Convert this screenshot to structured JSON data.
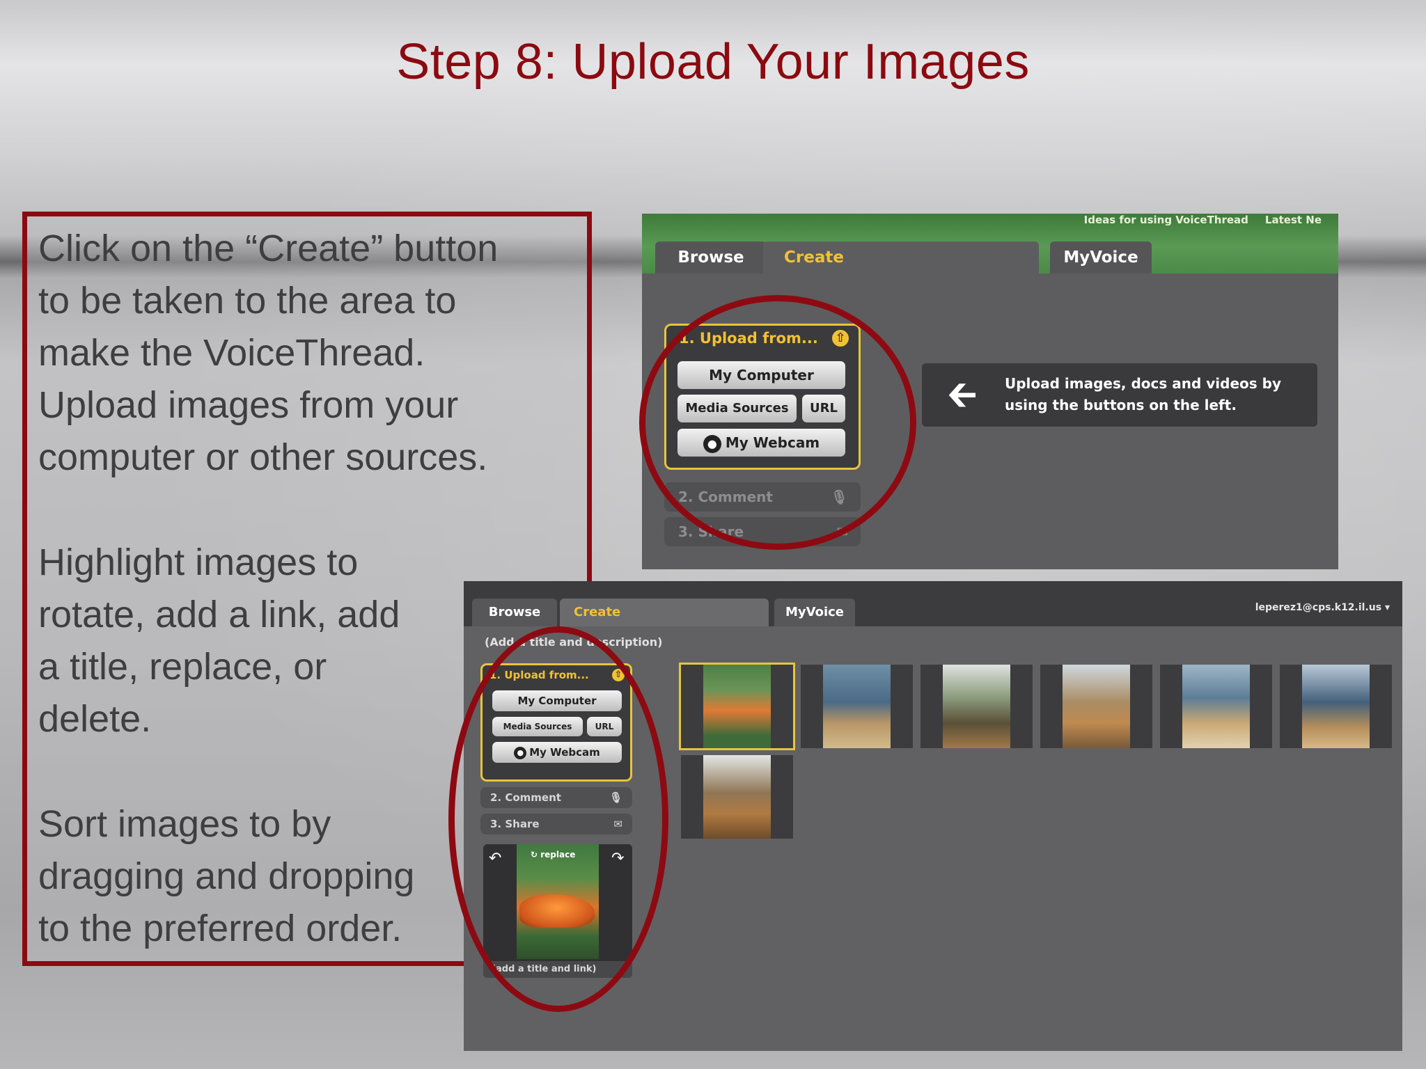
{
  "slide": {
    "title": "Step 8: Upload Your Images",
    "paragraphs": [
      "Click on the “Create” button\nto be taken to the area to\nmake the VoiceThread.\nUpload images from your\ncomputer or other sources.",
      "Highlight images to\nrotate, add a link, add\na title, replace, or\ndelete.",
      "Sort images to by\ndragging and dropping\nto the preferred order."
    ]
  },
  "shot1": {
    "top_links": [
      "Ideas for using VoiceThread",
      "Latest Ne"
    ],
    "tabs": [
      "Browse",
      "Create",
      "MyVoice"
    ],
    "upload_title": "1. Upload from...",
    "buttons": {
      "my_computer": "My Computer",
      "media_sources": "Media Sources",
      "url": "URL",
      "webcam": "My Webcam"
    },
    "step2": "2. Comment",
    "step3": "3. Share",
    "hint": "Upload images, docs and videos by using the buttons on the left."
  },
  "shot2": {
    "tabs": [
      "Browse",
      "Create",
      "MyVoice"
    ],
    "user": "leperez1@cps.k12.il.us",
    "add_title": "(Add a title and description)",
    "upload_title": "1. Upload from...",
    "buttons": {
      "my_computer": "My Computer",
      "media_sources": "Media Sources",
      "url": "URL",
      "webcam": "My Webcam"
    },
    "step2": "2. Comment",
    "step3": "3. Share",
    "replace": "replace",
    "preview_caption": "(add a title and link)"
  },
  "colors": {
    "title": "#8b0a10",
    "accent": "#f1c232",
    "circle": "#8e0a12",
    "header_green": "#4b8a47"
  },
  "icons": [
    "upload-arrow-icon",
    "webcam-icon",
    "microphone-icon",
    "envelope-icon",
    "left-arrow-icon",
    "rotate-left-icon",
    "rotate-right-icon",
    "dropdown-caret-icon"
  ]
}
